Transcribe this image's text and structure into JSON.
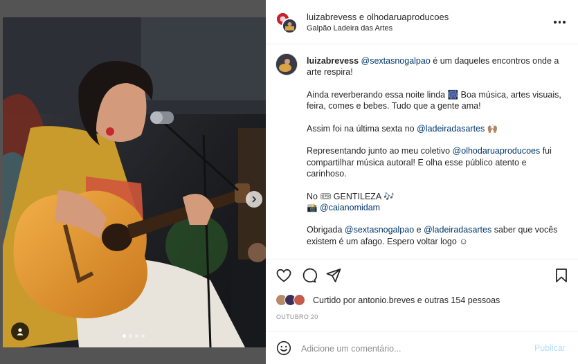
{
  "post": {
    "header": {
      "users": "luizabrevess e olhodaruaproducoes",
      "location": "Galpão Ladeira das Artes"
    },
    "caption": {
      "username": "luizabrevess",
      "line1_mention": "@sextasnogalpao",
      "line1_rest": " é um daqueles encontros onde a arte respira!",
      "p2": "Ainda reverberando essa noite linda 🎆 Boa música, artes visuais, feira, comes e bebes. Tudo que a gente ama!",
      "p3_pre": "Assim foi na última sexta no ",
      "p3_mention": "@ladeiradasartes",
      "p3_post": " 🙌🏽",
      "p4_pre": "Representando junto ao meu coletivo ",
      "p4_mention": "@olhodaruaproducoes",
      "p4_post": " fui compartilhar música autoral! E olha esse público atento e carinhoso.",
      "p5_line1": "No 🎟 GENTILEZA 🎶",
      "p5_icon": "📸 ",
      "p5_mention": "@caianomidam",
      "p6_pre": "Obrigada ",
      "p6_mention1": "@sextasnogalpao",
      "p6_mid": " e ",
      "p6_mention2": "@ladeiradasartes",
      "p6_post": " saber que vocês existem é um afago. Espero voltar logo ☺"
    },
    "likes_text": "Curtido por antonio.breves e outras 154 pessoas",
    "date": "OUTUBRO 20",
    "comment": {
      "placeholder": "Adicione um comentário...",
      "publish_label": "Publicar"
    },
    "carousel": {
      "count": 4,
      "active_index": 0
    },
    "icons": {
      "more": "more-options-icon",
      "like": "heart-icon",
      "comment": "comment-icon",
      "share": "share-icon",
      "save": "bookmark-icon",
      "emoji": "emoji-icon",
      "next": "chevron-right-icon",
      "tag": "user-tag-icon"
    },
    "colors": {
      "link": "#00376b",
      "publish_disabled": "#b2dffc",
      "text": "#262626",
      "muted": "#8e8e8e"
    }
  }
}
